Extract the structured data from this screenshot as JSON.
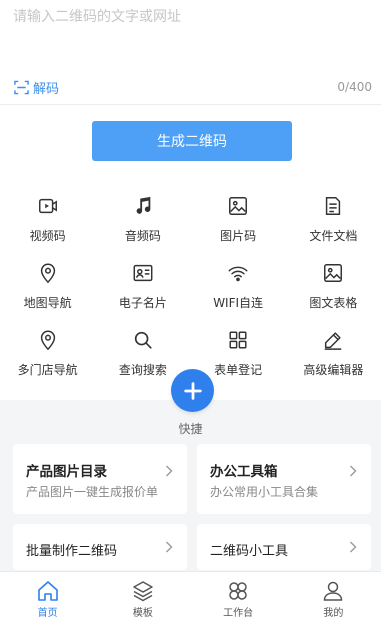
{
  "input": {
    "placeholder": "请输入二维码的文字或网址",
    "value": "",
    "char_count": "0/400"
  },
  "decode": {
    "label": "解码",
    "icon": "scan-icon"
  },
  "generate_button": {
    "label": "生成二维码"
  },
  "grid": [
    {
      "id": "video",
      "label": "视频码",
      "icon": "video-icon"
    },
    {
      "id": "audio",
      "label": "音频码",
      "icon": "music-note-icon"
    },
    {
      "id": "image",
      "label": "图片码",
      "icon": "image-icon"
    },
    {
      "id": "doc",
      "label": "文件文档",
      "icon": "document-icon"
    },
    {
      "id": "map",
      "label": "地图导航",
      "icon": "location-pin-icon"
    },
    {
      "id": "card",
      "label": "电子名片",
      "icon": "contact-card-icon"
    },
    {
      "id": "wifi",
      "label": "WIFI自连",
      "icon": "wifi-icon"
    },
    {
      "id": "table",
      "label": "图文表格",
      "icon": "picture-icon"
    },
    {
      "id": "multistore",
      "label": "多门店导航",
      "icon": "location-pin-icon"
    },
    {
      "id": "search",
      "label": "查询搜索",
      "icon": "search-icon"
    },
    {
      "id": "form",
      "label": "表单登记",
      "icon": "grid-icon"
    },
    {
      "id": "editor",
      "label": "高级编辑器",
      "icon": "pencil-icon"
    }
  ],
  "quick": {
    "label": "快捷",
    "icon": "plus-icon"
  },
  "cards": [
    {
      "title": "产品图片目录",
      "subtitle": "产品图片一键生成报价单"
    },
    {
      "title": "办公工具箱",
      "subtitle": "办公常用小工具合集"
    },
    {
      "title": "批量制作二维码"
    },
    {
      "title": "二维码小工具"
    }
  ],
  "tabs": [
    {
      "label": "首页",
      "icon": "home-icon",
      "active": true
    },
    {
      "label": "模板",
      "icon": "layers-icon",
      "active": false
    },
    {
      "label": "工作台",
      "icon": "clover-icon",
      "active": false
    },
    {
      "label": "我的",
      "icon": "user-icon",
      "active": false
    }
  ],
  "colors": {
    "accent": "#2f80ed",
    "generate_button": "#4ea0f7",
    "background_gray": "#f4f5f7"
  }
}
